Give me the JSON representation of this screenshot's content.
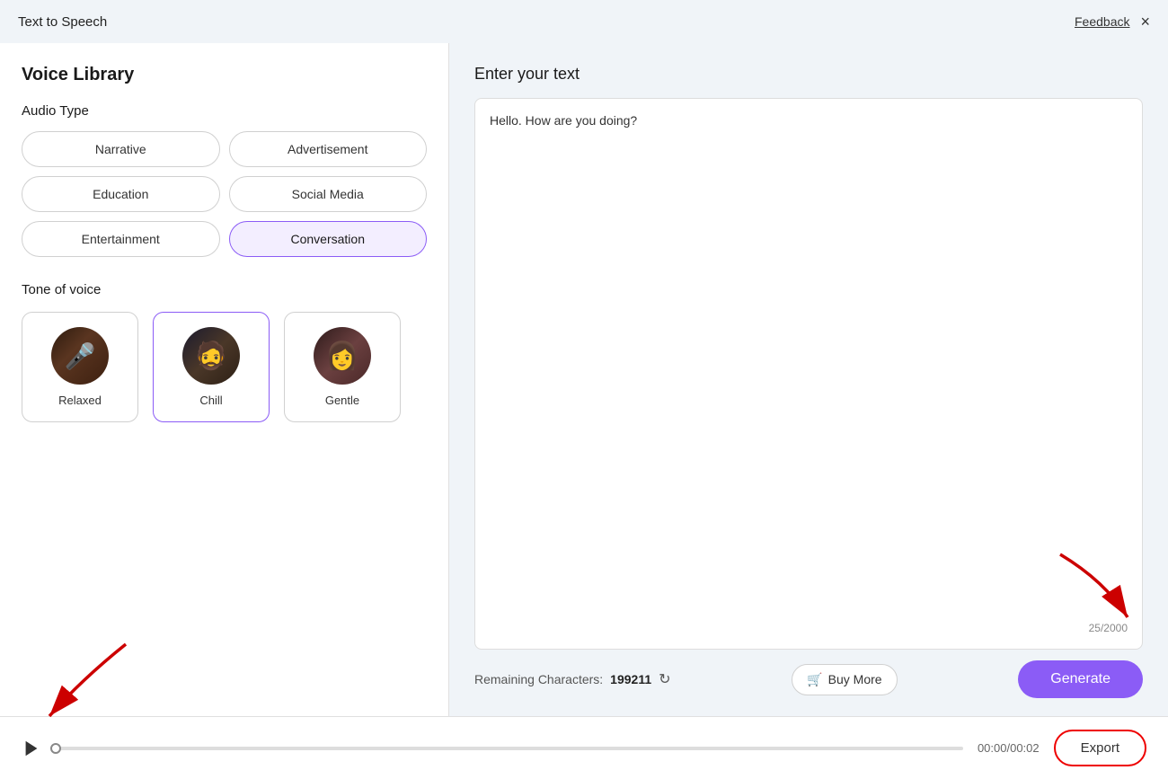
{
  "titleBar": {
    "title": "Text to Speech",
    "feedbackLabel": "Feedback",
    "closeIcon": "×"
  },
  "leftPanel": {
    "title": "Voice Library",
    "audioTypeLabel": "Audio Type",
    "audioTypes": [
      {
        "id": "narrative",
        "label": "Narrative",
        "active": false
      },
      {
        "id": "advertisement",
        "label": "Advertisement",
        "active": false
      },
      {
        "id": "education",
        "label": "Education",
        "active": false
      },
      {
        "id": "social-media",
        "label": "Social Media",
        "active": false
      },
      {
        "id": "entertainment",
        "label": "Entertainment",
        "active": false
      },
      {
        "id": "conversation",
        "label": "Conversation",
        "active": true
      }
    ],
    "toneLabel": "Tone of voice",
    "tones": [
      {
        "id": "relaxed",
        "label": "Relaxed",
        "active": false
      },
      {
        "id": "chill",
        "label": "Chill",
        "active": true
      },
      {
        "id": "gentle",
        "label": "Gentle",
        "active": false
      }
    ]
  },
  "rightPanel": {
    "title": "Enter your text",
    "textValue": "Hello. How are you doing?",
    "charCount": "25/2000",
    "remainingLabel": "Remaining Characters:",
    "remainingCount": "199211",
    "buyMoreLabel": "Buy More",
    "generateLabel": "Generate"
  },
  "playback": {
    "timeDisplay": "00:00/00:02",
    "exportLabel": "Export"
  }
}
